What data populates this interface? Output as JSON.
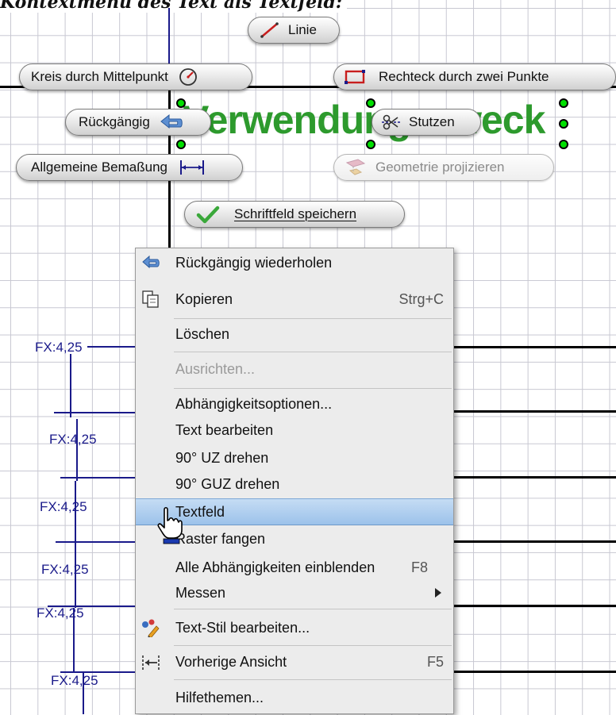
{
  "caption": "Kontextmenü des Text als Textfeld:",
  "drawing": {
    "big_text": "Verwendungszweck",
    "dimensions": [
      "FX:4,25",
      "FX:4,25",
      "FX:4,25",
      "FX:4,25",
      "FX:4,25",
      "FX:4,25"
    ]
  },
  "marking_menu": {
    "line": "Linie",
    "circle": "Kreis durch Mittelpunkt",
    "rectangle": "Rechteck durch zwei Punkte",
    "undo": "Rückgängig",
    "trim": "Stutzen",
    "dimension": "Allgemeine Bemaßung",
    "project": "Geometrie projizieren",
    "save_titleblock": "Schriftfeld speichern"
  },
  "context_menu": {
    "items": [
      {
        "label": "Rückgängig wiederholen",
        "icon": "redo-arrow-icon"
      },
      {
        "label": "Kopieren",
        "shortcut": "Strg+C",
        "icon": "copy-icon"
      },
      {
        "label": "Löschen"
      },
      {
        "label": "Ausrichten...",
        "disabled": true
      },
      {
        "label": "Abhängigkeitsoptionen..."
      },
      {
        "label": "Text bearbeiten"
      },
      {
        "label": "90° UZ drehen"
      },
      {
        "label": "90° GUZ drehen"
      },
      {
        "label": "Textfeld",
        "highlighted": true
      },
      {
        "label": "Raster fangen"
      },
      {
        "label": "Alle Abhängigkeiten einblenden",
        "shortcut": "F8"
      },
      {
        "label": "Messen",
        "submenu": true
      },
      {
        "label": "Text-Stil bearbeiten...",
        "icon": "text-style-icon"
      },
      {
        "label": "Vorherige Ansicht",
        "shortcut": "F5",
        "icon": "previous-view-icon"
      },
      {
        "label": "Hilfethemen..."
      }
    ]
  },
  "colors": {
    "accent_green": "#2d9a2d",
    "dimension_blue": "#1a1a8a",
    "highlight": "#9cc2ea"
  }
}
